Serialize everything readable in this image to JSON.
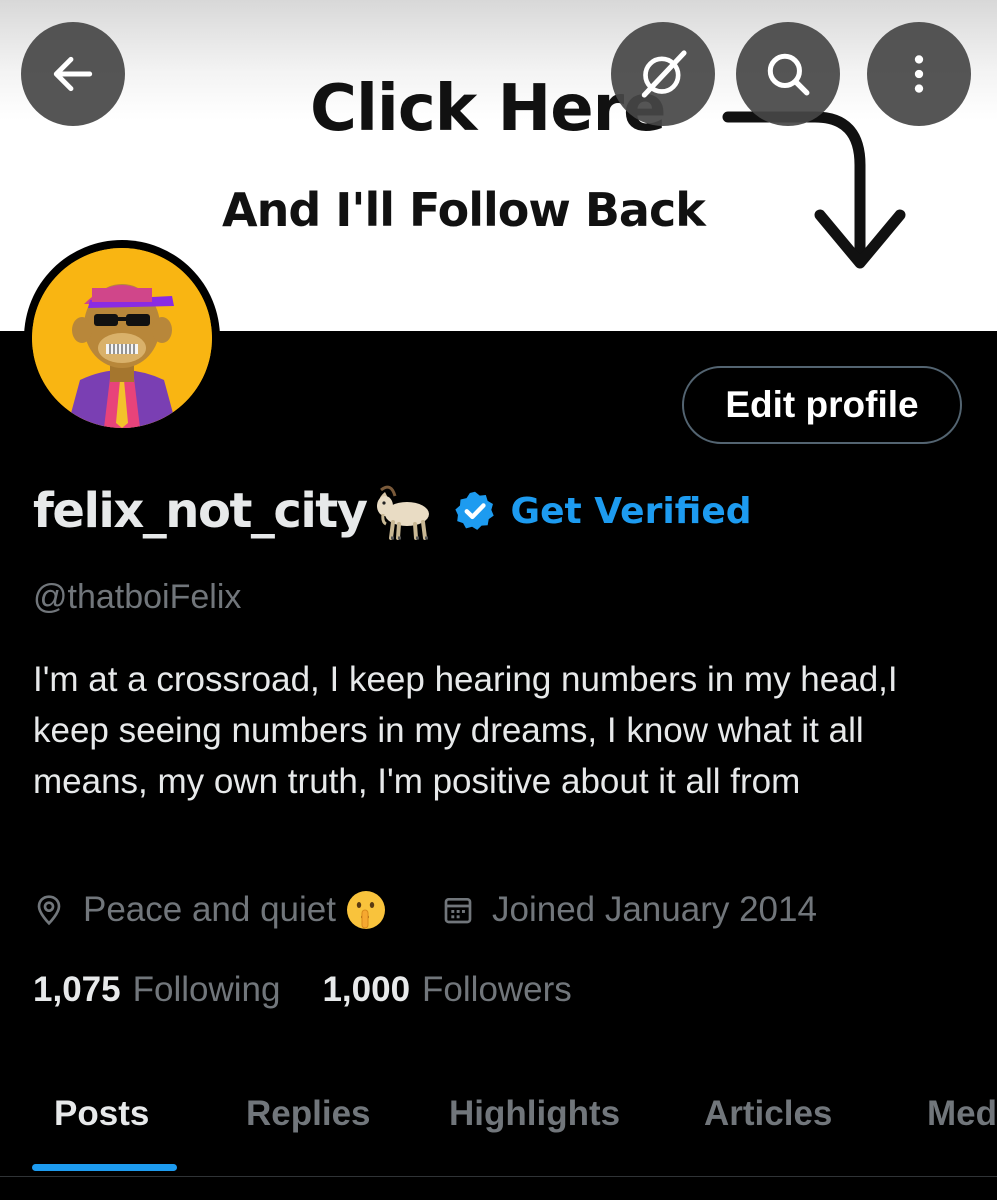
{
  "banner": {
    "line1": "Click Here",
    "line2": "And I'll Follow Back"
  },
  "header": {
    "back_icon": "arrow-left-icon",
    "grok_icon": "grok-slash-circle-icon",
    "search_icon": "search-icon",
    "more_icon": "more-vertical-icon"
  },
  "profile": {
    "display_name": "felix_not_city",
    "name_emoji": "goat-emoji",
    "verified_link": "Get Verified",
    "handle": "@thatboiFelix",
    "bio": "I'm at a crossroad, I keep hearing numbers in my head,I keep seeing numbers in my dreams, I know what it all means, my own truth, I'm positive about it all from",
    "location": "Peace and quiet",
    "location_emoji": "shushing-face-emoji",
    "joined": "Joined January 2014",
    "edit_button": "Edit profile"
  },
  "stats": {
    "following_count": "1,075",
    "following_label": "Following",
    "followers_count": "1,000",
    "followers_label": "Followers"
  },
  "tabs": [
    {
      "label": "Posts",
      "active": true
    },
    {
      "label": "Replies",
      "active": false
    },
    {
      "label": "Highlights",
      "active": false
    },
    {
      "label": "Articles",
      "active": false
    },
    {
      "label": "Media",
      "active": false
    }
  ],
  "colors": {
    "accent": "#1d9bf0",
    "background": "#000000",
    "primary_text": "#e7e9ea",
    "secondary_text": "#71767b",
    "avatar_bg": "#f9b512"
  }
}
